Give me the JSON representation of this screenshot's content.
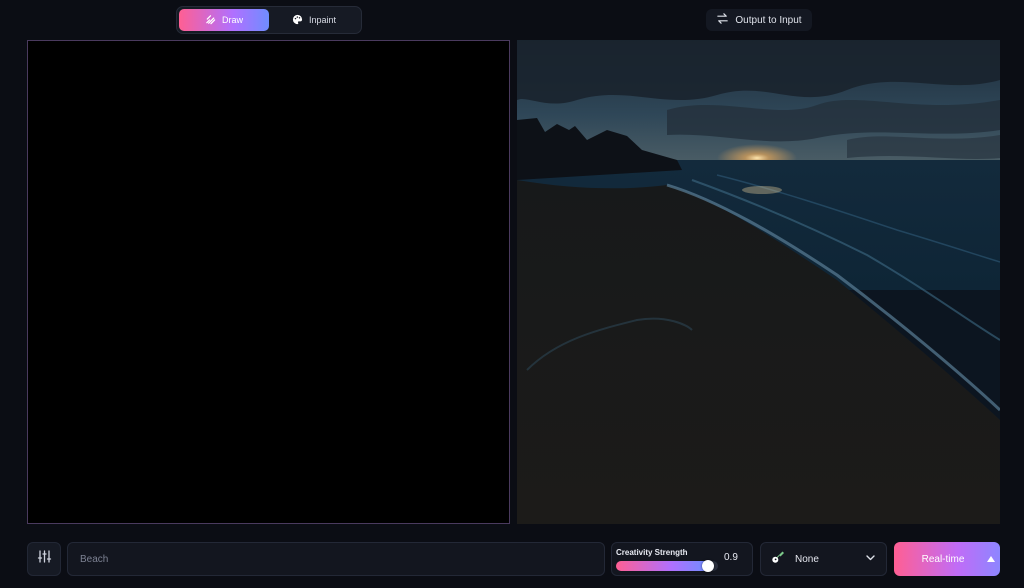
{
  "mode_toggle": {
    "draw_label": "Draw",
    "inpaint_label": "Inpaint",
    "active": "draw"
  },
  "toolbar": {
    "output_to_input_label": "Output to Input"
  },
  "prompt": {
    "placeholder": "Beach",
    "value": ""
  },
  "creativity": {
    "label": "Creativity Strength",
    "value_text": "0.9",
    "value": 0.9
  },
  "style_select": {
    "selected": "None",
    "icon": "guitar-icon"
  },
  "realtime": {
    "label": "Real-time"
  },
  "colors": {
    "accent_start": "#ff5f93",
    "accent_mid": "#b070ff",
    "accent_end": "#6f8dff",
    "background": "#0b0d14",
    "panel": "#13161f"
  }
}
